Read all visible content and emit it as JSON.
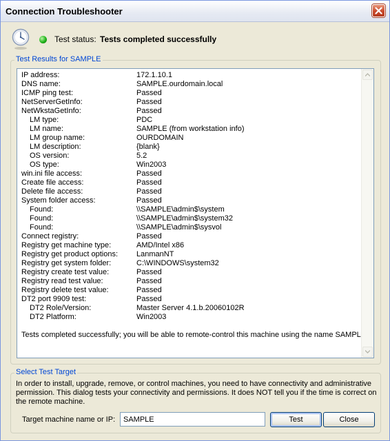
{
  "window": {
    "title": "Connection Troubleshooter"
  },
  "status": {
    "label": "Test status:",
    "value": "Tests completed successfully",
    "indicator_color": "#1fb31b"
  },
  "results": {
    "legend": "Test Results for SAMPLE",
    "rows": [
      {
        "key": "IP address:",
        "value": "172.1.10.1",
        "indent": false
      },
      {
        "key": "DNS name:",
        "value": "SAMPLE.ourdomain.local",
        "indent": false
      },
      {
        "key": "ICMP ping test:",
        "value": "Passed",
        "indent": false
      },
      {
        "key": "NetServerGetInfo:",
        "value": "Passed",
        "indent": false
      },
      {
        "key": "NetWkstaGetInfo:",
        "value": "Passed",
        "indent": false
      },
      {
        "key": "LM type:",
        "value": "PDC",
        "indent": true
      },
      {
        "key": "LM name:",
        "value": "SAMPLE (from workstation info)",
        "indent": true
      },
      {
        "key": "LM group name:",
        "value": "OURDOMAIN",
        "indent": true
      },
      {
        "key": "LM description:",
        "value": "{blank}",
        "indent": true
      },
      {
        "key": "OS version:",
        "value": "5.2",
        "indent": true
      },
      {
        "key": "OS type:",
        "value": "Win2003",
        "indent": true
      },
      {
        "key": "win.ini file access:",
        "value": "Passed",
        "indent": false
      },
      {
        "key": "Create file access:",
        "value": "Passed",
        "indent": false
      },
      {
        "key": "Delete file access:",
        "value": "Passed",
        "indent": false
      },
      {
        "key": "System folder access:",
        "value": "Passed",
        "indent": false
      },
      {
        "key": "Found:",
        "value": "\\\\SAMPLE\\admin$\\system",
        "indent": true
      },
      {
        "key": "Found:",
        "value": "\\\\SAMPLE\\admin$\\system32",
        "indent": true
      },
      {
        "key": "Found:",
        "value": "\\\\SAMPLE\\admin$\\sysvol",
        "indent": true
      },
      {
        "key": "Connect registry:",
        "value": "Passed",
        "indent": false
      },
      {
        "key": "Registry get machine type:",
        "value": "AMD/Intel x86",
        "indent": false
      },
      {
        "key": "Registry get product options:",
        "value": "LanmanNT",
        "indent": false
      },
      {
        "key": "Registry get system folder:",
        "value": "C:\\WINDOWS\\system32",
        "indent": false
      },
      {
        "key": "Registry create test value:",
        "value": "Passed",
        "indent": false
      },
      {
        "key": "Registry read test value:",
        "value": "Passed",
        "indent": false
      },
      {
        "key": "Registry delete test value:",
        "value": "Passed",
        "indent": false
      },
      {
        "key": "DT2 port 9909 test:",
        "value": "Passed",
        "indent": false
      },
      {
        "key": "DT2 Role/Version:",
        "value": "Master Server 4.1.b.20060102R",
        "indent": true
      },
      {
        "key": "DT2 Platform:",
        "value": "Win2003",
        "indent": true
      }
    ],
    "summary": "Tests completed successfully; you will be able to remote-control this machine using the name SAMPLE"
  },
  "target": {
    "legend": "Select Test Target",
    "description": "In order to install, upgrade, remove, or control machines, you need to have connectivity and administrative permission. This dialog tests your connectivity and permissions. It does NOT tell you if the time is correct on the remote machine.",
    "label": "Target machine name or IP:",
    "input_value": "SAMPLE",
    "test_label": "Test",
    "close_label": "Close"
  },
  "icons": {
    "close": "close-icon",
    "clock": "clock-icon",
    "status": "status-led-icon"
  }
}
